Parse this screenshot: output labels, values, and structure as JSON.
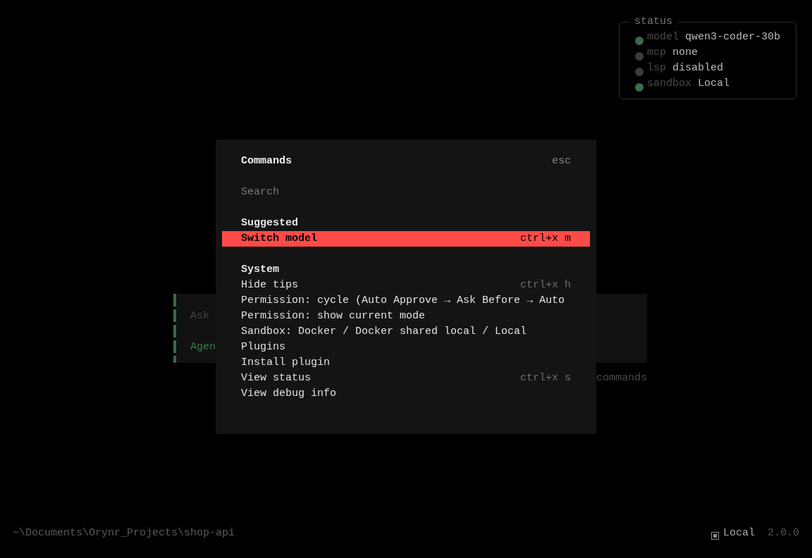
{
  "status": {
    "title": "status",
    "items": [
      {
        "label": "model",
        "value": "qwen3-coder-30b",
        "color": "#3d6b45"
      },
      {
        "label": "mcp",
        "value": "none",
        "color": "#3c3c3c"
      },
      {
        "label": "lsp",
        "value": "disabled",
        "color": "#3c3c3c"
      },
      {
        "label": "sandbox",
        "value": "Local",
        "color": "#3d6b45"
      }
    ]
  },
  "prompt_panel": {
    "placeholder": "Ask",
    "mode": "Agen"
  },
  "hint": "commands",
  "command_palette": {
    "title": "Commands",
    "close_hint": "esc",
    "search": {
      "placeholder": "Search"
    },
    "sections": [
      {
        "heading": "Suggested",
        "items": [
          {
            "label": "Switch model",
            "shortcut": "ctrl+x m",
            "selected": true
          }
        ]
      },
      {
        "heading": "System",
        "items": [
          {
            "label": "Hide tips",
            "shortcut": "ctrl+x h",
            "selected": false
          },
          {
            "label": "Permission: cycle (Auto Approve → Ask Before → Auto",
            "selected": false
          },
          {
            "label": "Permission: show current mode",
            "selected": false
          },
          {
            "label": "Sandbox: Docker / Docker shared local / Local",
            "selected": false
          },
          {
            "label": "Plugins",
            "selected": false
          },
          {
            "label": "Install plugin",
            "selected": false
          },
          {
            "label": "View status",
            "shortcut": "ctrl+x s",
            "selected": false
          },
          {
            "label": "View debug info",
            "selected": false
          }
        ]
      }
    ]
  },
  "footer": {
    "path": "~\\Documents\\Orynr_Projects\\shop-api",
    "sandbox": "Local",
    "version": "2.0.0"
  }
}
